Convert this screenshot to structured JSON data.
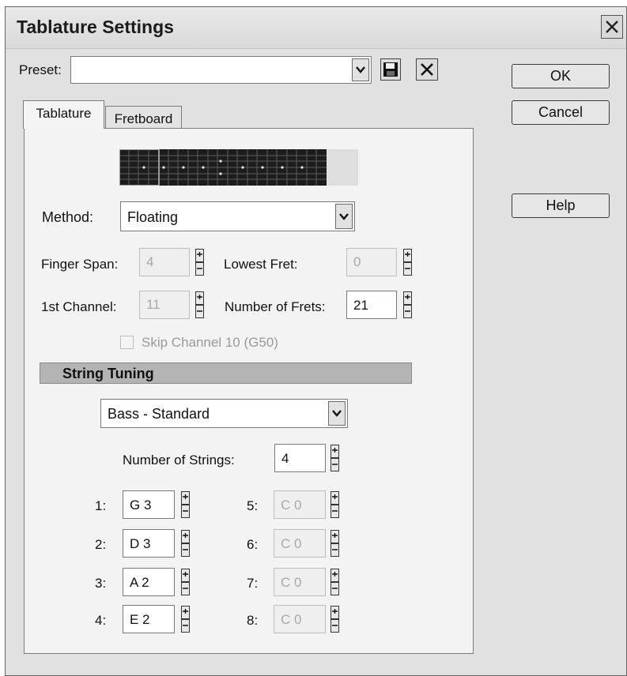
{
  "window": {
    "title": "Tablature Settings"
  },
  "preset": {
    "label": "Preset:",
    "value": ""
  },
  "buttons": {
    "ok": "OK",
    "cancel": "Cancel",
    "help": "Help"
  },
  "tabs": [
    {
      "label": "Tablature",
      "active": true
    },
    {
      "label": "Fretboard",
      "active": false
    }
  ],
  "tablature": {
    "method": {
      "label": "Method:",
      "value": "Floating"
    },
    "finger_span": {
      "label": "Finger Span:",
      "value": "4"
    },
    "lowest_fret": {
      "label": "Lowest Fret:",
      "value": "0"
    },
    "first_channel": {
      "label": "1st Channel:",
      "value": "11"
    },
    "number_of_frets": {
      "label": "Number of Frets:",
      "value": "21"
    },
    "skip_channel": {
      "label": "Skip Channel 10 (G50)",
      "checked": false
    }
  },
  "string_tuning": {
    "header": "String Tuning",
    "preset": "Bass - Standard",
    "number_of_strings": {
      "label": "Number of Strings:",
      "value": "4"
    },
    "strings": [
      {
        "label": "1:",
        "value": "G 3",
        "enabled": true
      },
      {
        "label": "2:",
        "value": "D 3",
        "enabled": true
      },
      {
        "label": "3:",
        "value": "A 2",
        "enabled": true
      },
      {
        "label": "4:",
        "value": "E 2",
        "enabled": true
      },
      {
        "label": "5:",
        "value": "C 0",
        "enabled": false
      },
      {
        "label": "6:",
        "value": "C 0",
        "enabled": false
      },
      {
        "label": "7:",
        "value": "C 0",
        "enabled": false
      },
      {
        "label": "8:",
        "value": "C 0",
        "enabled": false
      }
    ]
  },
  "icons": {
    "close": "close-icon",
    "save": "floppy-disk-icon",
    "delete": "delete-x-icon",
    "dropdown": "chevron-down-icon",
    "spinner": "spinner-up-down-icon"
  }
}
